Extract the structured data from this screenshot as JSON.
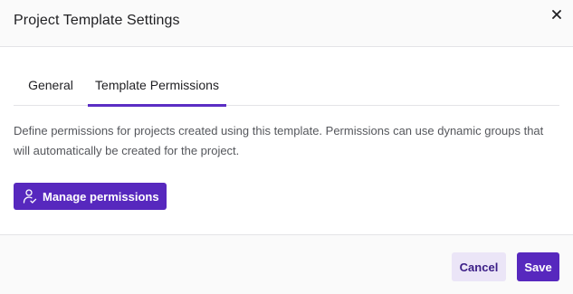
{
  "dialog": {
    "title": "Project Template Settings",
    "close_icon": "close-icon"
  },
  "tabs": [
    {
      "label": "General",
      "active": false
    },
    {
      "label": "Template Permissions",
      "active": true
    }
  ],
  "content": {
    "description": "Define permissions for projects created using this template. Permissions can use dynamic groups that will automatically be created for the project.",
    "manage_button": {
      "label": "Manage permissions",
      "icon": "user-permissions-icon"
    }
  },
  "footer": {
    "cancel_label": "Cancel",
    "save_label": "Save"
  },
  "colors": {
    "accent": "#5728be",
    "secondary_button_bg": "#ebe5f7",
    "secondary_button_text": "#3a1d86",
    "header_bg": "#fafafa"
  }
}
